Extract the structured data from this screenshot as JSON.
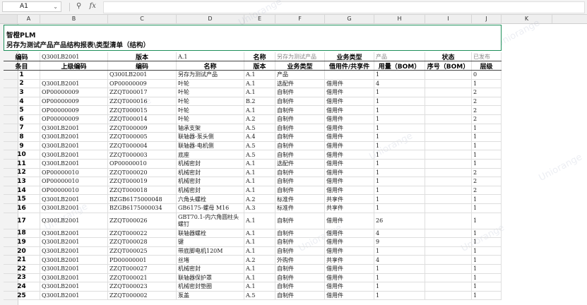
{
  "formula_bar": {
    "cell_ref": "A1",
    "zoom_icon": "magnifier-icon",
    "fx_label": "fx",
    "formula": ""
  },
  "columns": [
    "A",
    "B",
    "C",
    "D",
    "E",
    "F",
    "G",
    "H",
    "I",
    "J",
    "K"
  ],
  "title": {
    "line1": "智橙PLM",
    "line2": "另存为测试产品产品结构报表\\类型清单（结构）"
  },
  "summary_row": {
    "code_label": "编码",
    "code_value": "Q300LB2001",
    "version_label": "版本",
    "version_value": "A.1",
    "name_label": "名称",
    "name_value": "另存为测试产品",
    "type_label": "业务类型",
    "type_value": "产品",
    "status_label": "状态",
    "status_value": "已发布"
  },
  "table_headers": [
    "条目",
    "上级编码",
    "编码",
    "名称",
    "版本",
    "业务类型",
    "借用件/共享件",
    "用量（BOM）",
    "序号（BOM）",
    "层级"
  ],
  "rows": [
    [
      "1",
      "",
      "Q300LB2001",
      "另存为测试产品",
      "A.1",
      "产品",
      "",
      "1",
      "",
      "0"
    ],
    [
      "2",
      "Q300LB2001",
      "OP00000009",
      "叶轮",
      "A.1",
      "选配件",
      "借用件",
      "4",
      "",
      "1"
    ],
    [
      "3",
      "OP00000009",
      "ZZQT000017",
      "叶轮",
      "A.1",
      "自制件",
      "借用件",
      "1",
      "",
      "2"
    ],
    [
      "4",
      "OP00000009",
      "ZZQT000016",
      "叶轮",
      "B.2",
      "自制件",
      "借用件",
      "1",
      "",
      "2"
    ],
    [
      "5",
      "OP00000009",
      "ZZQT000015",
      "叶轮",
      "A.1",
      "自制件",
      "借用件",
      "1",
      "",
      "2"
    ],
    [
      "6",
      "OP00000009",
      "ZZQT000014",
      "叶轮",
      "A.2",
      "自制件",
      "借用件",
      "1",
      "",
      "2"
    ],
    [
      "7",
      "Q300LB2001",
      "ZZQT000009",
      "轴承支架",
      "A.5",
      "自制件",
      "借用件",
      "1",
      "",
      "1"
    ],
    [
      "8",
      "Q300LB2001",
      "ZZQT000005",
      "联轴器-泵头侧",
      "A.4",
      "自制件",
      "借用件",
      "1",
      "",
      "1"
    ],
    [
      "9",
      "Q300LB2001",
      "ZZQT000004",
      "联轴器-电机侧",
      "A.5",
      "自制件",
      "借用件",
      "1",
      "",
      "1"
    ],
    [
      "10",
      "Q300LB2001",
      "ZZQT000003",
      "底座",
      "A.5",
      "自制件",
      "借用件",
      "1",
      "",
      "1"
    ],
    [
      "11",
      "Q300LB2001",
      "OP00000010",
      "机械密封",
      "A.1",
      "选配件",
      "借用件",
      "1",
      "",
      "1"
    ],
    [
      "12",
      "OP00000010",
      "ZZQT000020",
      "机械密封",
      "A.1",
      "自制件",
      "借用件",
      "1",
      "",
      "2"
    ],
    [
      "13",
      "OP00000010",
      "ZZQT000019",
      "机械密封",
      "A.1",
      "自制件",
      "借用件",
      "1",
      "",
      "2"
    ],
    [
      "14",
      "OP00000010",
      "ZZQT000018",
      "机械密封",
      "A.1",
      "自制件",
      "借用件",
      "1",
      "",
      "2"
    ],
    [
      "15",
      "Q300LB2001",
      "BZGB6175000048",
      "六角头螺栓",
      "A.2",
      "标准件",
      "共享件",
      "1",
      "",
      "1"
    ],
    [
      "16",
      "Q300LB2001",
      "BZGB6175000034",
      "GB6175-螺母 M16",
      "A.3",
      "标准件",
      "共享件",
      "1",
      "",
      "1"
    ],
    [
      "17",
      "Q300LB2001",
      "ZZQT000026",
      "GBT70.1-内六角圆柱头螺钉",
      "A.1",
      "自制件",
      "借用件",
      "26",
      "",
      "1"
    ],
    [
      "18",
      "Q300LB2001",
      "ZZQT000022",
      "联轴器螺栓",
      "A.1",
      "自制件",
      "借用件",
      "4",
      "",
      "1"
    ],
    [
      "19",
      "Q300LB2001",
      "ZZQT000028",
      "键",
      "A.1",
      "自制件",
      "借用件",
      "9",
      "",
      "1"
    ],
    [
      "20",
      "Q300LB2001",
      "ZZQT000025",
      "带底脚电机120M",
      "A.1",
      "自制件",
      "借用件",
      "1",
      "",
      "1"
    ],
    [
      "21",
      "Q300LB2001",
      "PD00000001",
      "丝堵",
      "A.2",
      "外购件",
      "共享件",
      "4",
      "",
      "1"
    ],
    [
      "22",
      "Q300LB2001",
      "ZZQT000027",
      "机械密封",
      "A.1",
      "自制件",
      "借用件",
      "1",
      "",
      "1"
    ],
    [
      "23",
      "Q300LB2001",
      "ZZQT000021",
      "联轴器保护罩",
      "A.1",
      "自制件",
      "借用件",
      "1",
      "",
      "1"
    ],
    [
      "24",
      "Q300LB2001",
      "ZZQT000023",
      "机械密封垫圈",
      "A.1",
      "自制件",
      "借用件",
      "1",
      "",
      "1"
    ],
    [
      "25",
      "Q300LB2001",
      "ZZQT000002",
      "泵盖",
      "A.5",
      "自制件",
      "借用件",
      "1",
      "",
      "1"
    ]
  ],
  "watermark_text": "Uniorange"
}
